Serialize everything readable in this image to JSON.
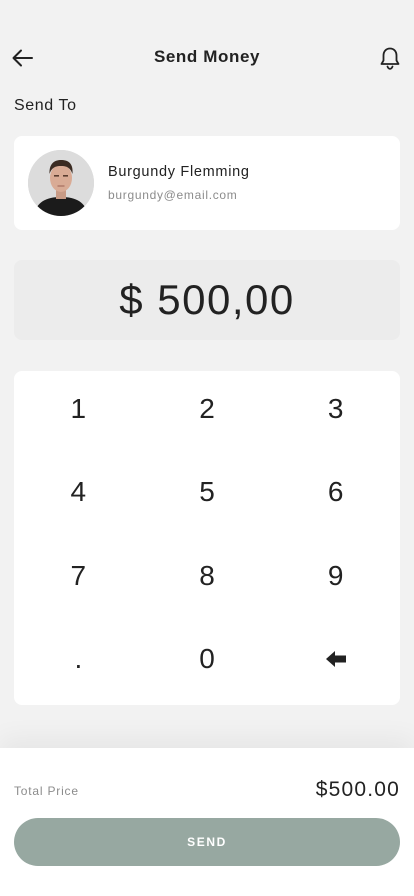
{
  "header": {
    "title": "Send Money",
    "back_icon": "arrow-left-icon",
    "bell_icon": "bell-icon"
  },
  "send_to_label": "Send To",
  "recipient": {
    "name": "Burgundy Flemming",
    "email": "burgundy@email.com",
    "avatar_icon": "user-avatar"
  },
  "amount": "$ 500,00",
  "keypad": {
    "keys": [
      "1",
      "2",
      "3",
      "4",
      "5",
      "6",
      "7",
      "8",
      "9",
      ".",
      "0"
    ],
    "backspace_icon": "backspace-arrow-icon"
  },
  "footer": {
    "total_label": "Total Price",
    "total_value": "$500.00",
    "send_label": "SEND",
    "send_button_color": "#97a8a1"
  }
}
